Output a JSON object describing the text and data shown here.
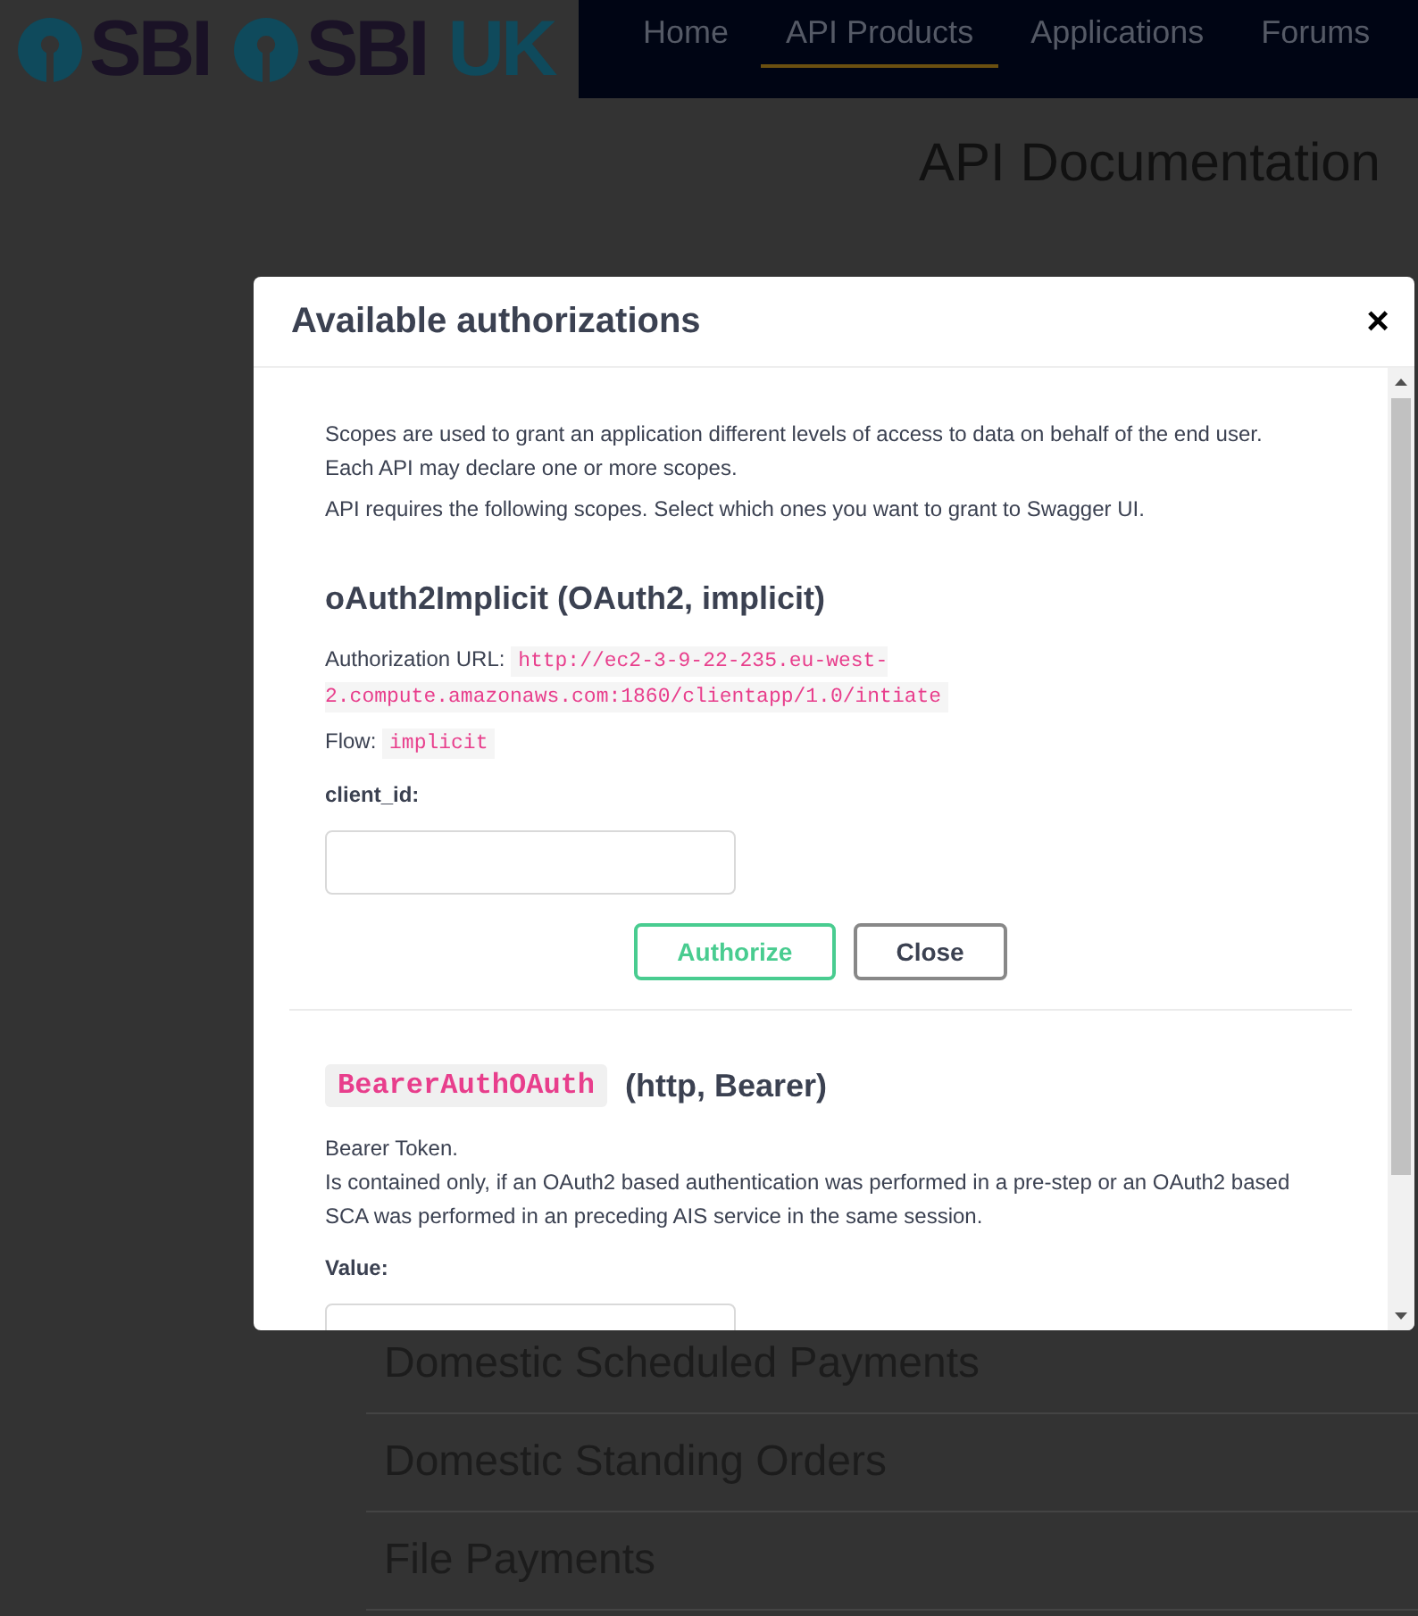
{
  "header": {
    "logos": [
      {
        "text": "SBI"
      },
      {
        "text": "SBI",
        "suffix": "UK"
      }
    ],
    "nav": [
      {
        "label": "Home",
        "selected": false
      },
      {
        "label": "API Products",
        "selected": true
      },
      {
        "label": "Applications",
        "selected": false
      },
      {
        "label": "Forums",
        "selected": false
      }
    ]
  },
  "page": {
    "title": "API Documentation",
    "sections": [
      "Domestic Scheduled Payments",
      "Domestic Standing Orders",
      "File Payments"
    ]
  },
  "modal": {
    "title": "Available authorizations",
    "close": "×",
    "intro_lines": [
      "Scopes are used to grant an application different levels of access to data on behalf of the end user.",
      "Each API may declare one or more scopes."
    ],
    "scopes_note": "API requires the following scopes. Select which ones you want to grant to Swagger UI.",
    "schemes": [
      {
        "kind": "oauth2",
        "name": "oAuth2Implicit",
        "type": "(OAuth2, implicit)",
        "url_label": "Authorization URL:",
        "url": "http://ec2-3-9-22-235.eu-west-2.compute.amazonaws.com:1860/clientapp/1.0/intiate",
        "flow_label": "Flow:",
        "flow": "implicit",
        "field_label": "client_id:",
        "buttons": [
          {
            "label": "Authorize",
            "kind": "primary"
          },
          {
            "label": "Close",
            "kind": "secondary"
          }
        ]
      },
      {
        "kind": "http",
        "name": "BearerAuthOAuth",
        "type": "(http, Bearer)",
        "description": [
          "Bearer Token.",
          "Is contained only, if an OAuth2 based authentication was performed in a pre-step or an OAuth2 based SCA was performed in an preceding AIS service in the same session."
        ],
        "field_label": "Value:"
      }
    ]
  }
}
